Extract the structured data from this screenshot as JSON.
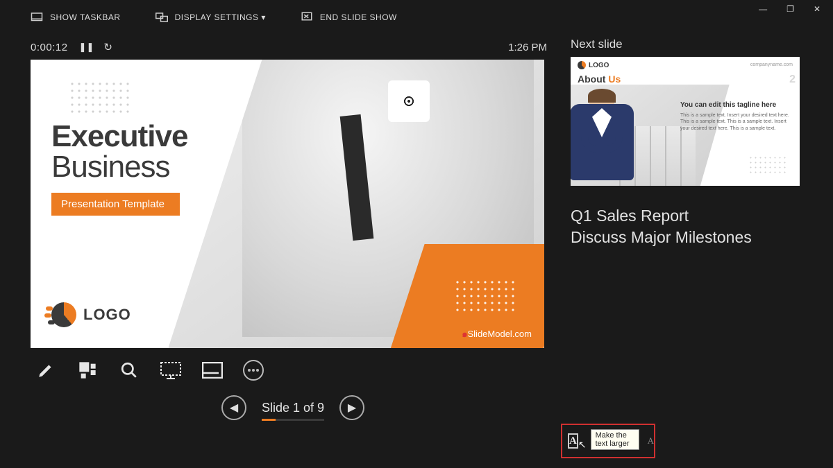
{
  "topbar": {
    "show_taskbar": "SHOW TASKBAR",
    "display_settings": "DISPLAY SETTINGS ▾",
    "end_show": "END SLIDE SHOW"
  },
  "timer": {
    "elapsed": "0:00:12",
    "clock": "1:26 PM"
  },
  "slide": {
    "title_line1": "Executive",
    "title_line2": "Business",
    "subtitle": "Presentation Template",
    "logo_text": "LOGO",
    "watermark": "SlideModel.com"
  },
  "nav": {
    "label": "Slide 1 of 9"
  },
  "next": {
    "header": "Next slide",
    "logo": "LOGO",
    "company": "companyname.com",
    "about_prefix": "About ",
    "about_bold": "Us",
    "slide_number": "2",
    "tagline": "You can edit this tagline here",
    "body": "This is a sample text. Insert your desired text here. This is a sample text. This is a sample text. Insert your desired text here. This is a sample text."
  },
  "notes": {
    "line1": "Q1 Sales Report",
    "line2": "Discuss Major Milestones"
  },
  "tooltip": {
    "larger": "Make the text larger"
  },
  "icons": {
    "bigA": "A",
    "smallA": "A"
  }
}
